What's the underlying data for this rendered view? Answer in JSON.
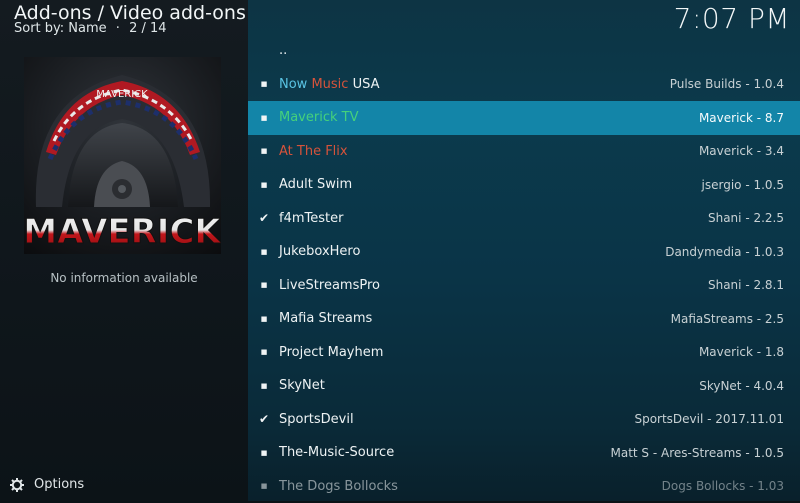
{
  "header": {
    "title": "Add-ons / Video add-ons",
    "sort": "Sort by: Name",
    "separator": "·",
    "position": "2 / 14",
    "clock": "7:07 PM"
  },
  "info_panel": {
    "thumbnail_brand": "MAVERICK",
    "helmet_text": "MAVERICK",
    "no_info": "No information available"
  },
  "footer": {
    "options_label": "Options",
    "options_icon": "gear-icon"
  },
  "colors": {
    "selected_bg": "#1385a8",
    "green": "#45d17b",
    "blue": "#59c3e3",
    "red": "#d6533b",
    "yellow": "#e7e09a"
  },
  "addons": [
    {
      "parts": [
        {
          "text": ".."
        }
      ],
      "meta": "",
      "mark": "none"
    },
    {
      "parts": [
        {
          "text": "Now ",
          "color": "#59c3e3"
        },
        {
          "text": "Music ",
          "color": "#d6533b"
        },
        {
          "text": "USA",
          "color": "#eef3f4"
        }
      ],
      "meta": "Pulse Builds - 1.0.4",
      "mark": "bullet"
    },
    {
      "parts": [
        {
          "text": "Maverick TV",
          "color": "#45d17b"
        }
      ],
      "meta": "Maverick - 8.7",
      "mark": "bullet",
      "selected": true
    },
    {
      "parts": [
        {
          "text": "At The Flix",
          "color": "#d6533b"
        }
      ],
      "meta": "Maverick - 3.4",
      "mark": "bullet"
    },
    {
      "parts": [
        {
          "text": "Adult Swim"
        }
      ],
      "meta": "jsergio - 1.0.5",
      "mark": "bullet"
    },
    {
      "parts": [
        {
          "text": "f4mTester"
        }
      ],
      "meta": "Shani - 2.2.5",
      "mark": "check"
    },
    {
      "parts": [
        {
          "text": "JukeboxHero"
        }
      ],
      "meta": "Dandymedia - 1.0.3",
      "mark": "bullet"
    },
    {
      "parts": [
        {
          "text": "LiveStreamsPro"
        }
      ],
      "meta": "Shani - 2.8.1",
      "mark": "bullet"
    },
    {
      "parts": [
        {
          "text": "Mafia Streams"
        }
      ],
      "meta": "MafiaStreams - 2.5",
      "mark": "bullet"
    },
    {
      "parts": [
        {
          "text": "Project Mayhem"
        }
      ],
      "meta": "Maverick - 1.8",
      "mark": "bullet"
    },
    {
      "parts": [
        {
          "text": "SkyNet"
        }
      ],
      "meta": "SkyNet - 4.0.4",
      "mark": "bullet"
    },
    {
      "parts": [
        {
          "text": "SportsDevil"
        }
      ],
      "meta": "SportsDevil - 2017.11.01",
      "mark": "check"
    },
    {
      "parts": [
        {
          "text": "The-Music-Source"
        }
      ],
      "meta": "Matt S - Ares-Streams - 1.0.5",
      "mark": "bullet"
    },
    {
      "parts": [
        {
          "text": "The Dogs Bollocks"
        }
      ],
      "meta": "Dogs Bollocks - 1.03",
      "mark": "bullet",
      "dim": true
    }
  ]
}
